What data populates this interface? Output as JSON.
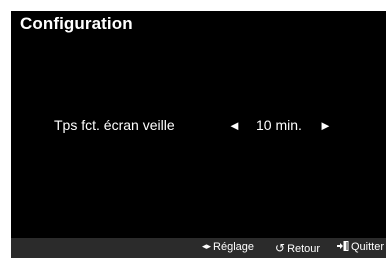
{
  "screen": {
    "title": "Configuration"
  },
  "setting": {
    "label": "Tps fct. écran veille",
    "value": "10 min.",
    "left_arrow": "◄",
    "right_arrow": "►"
  },
  "footer": {
    "adjust_icon": "◂▸",
    "adjust_label": "Réglage",
    "return_icon": "↺",
    "return_label": "Retour",
    "exit_label": "Quitter"
  },
  "colors": {
    "background": "#000000",
    "footer_bar": "#2b2b2b",
    "text": "#ffffff"
  }
}
